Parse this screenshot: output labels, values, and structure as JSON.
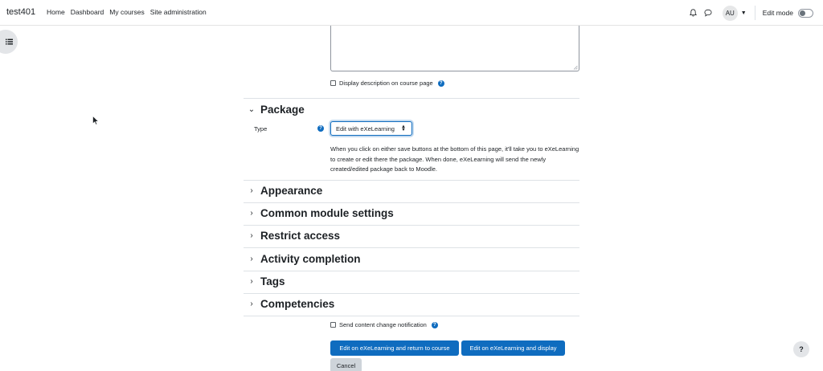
{
  "navbar": {
    "brand": "test401",
    "links": [
      "Home",
      "Dashboard",
      "My courses",
      "Site administration"
    ],
    "avatar_initials": "AU",
    "edit_mode_label": "Edit mode",
    "edit_mode_on": false
  },
  "form": {
    "display_description_label": "Display description on course page",
    "package_section": "Package",
    "type_label": "Type",
    "type_select_value": "Edit with eXeLearning",
    "package_description": "When you click on either save buttons at the bottom of this page, it'll take you to eXeLearning to create or edit there the package. When done, eXeLearning will send the newly created/edited package back to Moodle.",
    "sections": [
      "Appearance",
      "Common module settings",
      "Restrict access",
      "Activity completion",
      "Tags",
      "Competencies"
    ],
    "send_notification_label": "Send content change notification",
    "buttons": {
      "save_return": "Edit on eXeLearning and return to course",
      "save_display": "Edit on eXeLearning and display",
      "cancel": "Cancel"
    }
  },
  "help_button_label": "?",
  "colors": {
    "primary": "#0f6cbf",
    "text": "#1d2125",
    "border": "#dee2e6"
  }
}
